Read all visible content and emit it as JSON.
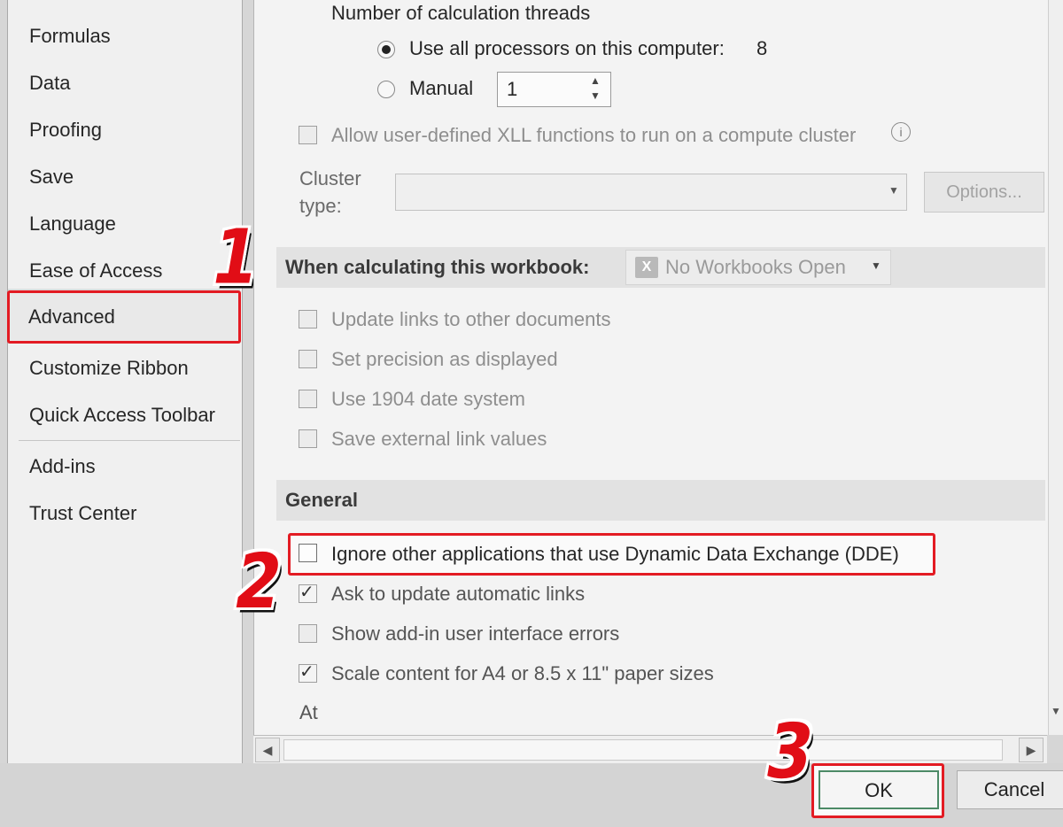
{
  "sidebar": {
    "items": [
      {
        "label": "Formulas"
      },
      {
        "label": "Data"
      },
      {
        "label": "Proofing"
      },
      {
        "label": "Save"
      },
      {
        "label": "Language"
      },
      {
        "label": "Ease of Access"
      },
      {
        "label": "Advanced",
        "selected": true
      },
      {
        "label": "Customize Ribbon"
      },
      {
        "label": "Quick Access Toolbar"
      },
      {
        "label": "Add-ins"
      },
      {
        "label": "Trust Center"
      }
    ]
  },
  "formulas": {
    "threads_label": "Number of calculation threads",
    "use_all_label": "Use all processors on this computer:",
    "processor_count": "8",
    "manual_label": "Manual",
    "manual_value": "1",
    "xll_label": "Allow user-defined XLL functions to run on a compute cluster",
    "cluster_label_line1": "Cluster",
    "cluster_label_line2": "type:",
    "cluster_value": "",
    "options_button": "Options..."
  },
  "workbook": {
    "title": "When calculating this workbook:",
    "dropdown_value": "No Workbooks Open",
    "options": [
      {
        "label": "Update links to other documents",
        "checked": false
      },
      {
        "label": "Set precision as displayed",
        "checked": false
      },
      {
        "label": "Use 1904 date system",
        "checked": false
      },
      {
        "label": "Save external link values",
        "checked": false
      }
    ]
  },
  "general": {
    "title": "General",
    "options": [
      {
        "label": "Ignore other applications that use Dynamic Data Exchange (DDE)",
        "checked": false
      },
      {
        "label": "Ask to update automatic links",
        "checked": true
      },
      {
        "label": "Show add-in user interface errors",
        "checked": false
      },
      {
        "label": "Scale content for A4 or 8.5 x 11\" paper sizes",
        "checked": true
      }
    ],
    "at_label": "At"
  },
  "footer": {
    "ok_label": "OK",
    "cancel_label": "Cancel"
  },
  "callouts": [
    "1",
    "2",
    "3"
  ],
  "colors": {
    "callout_red": "#e31b23",
    "ok_border": "#2e7d4f"
  }
}
